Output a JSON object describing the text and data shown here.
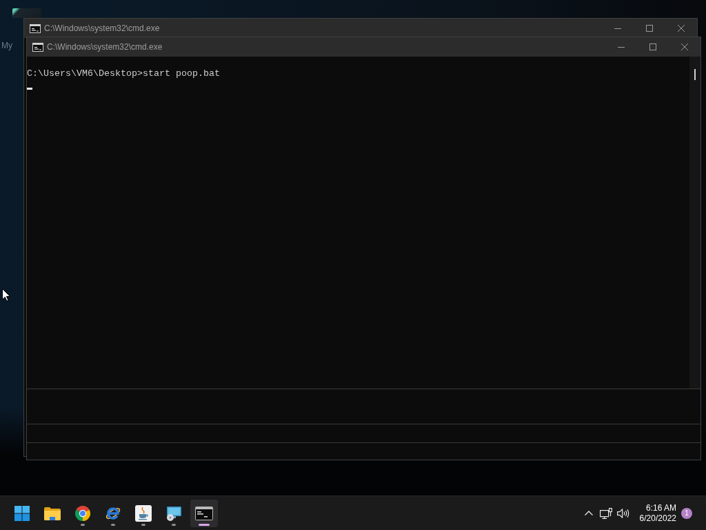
{
  "desktop": {
    "icons": [
      {
        "label": "My"
      }
    ]
  },
  "windows": [
    {
      "title": "C:\\Windows\\system32\\cmd.exe"
    },
    {
      "title": "C:\\Windows\\system32\\cmd.exe",
      "console": {
        "lines": [
          "C:\\Users\\VM6\\Desktop>start poop.bat"
        ]
      }
    }
  ],
  "taskbar": {
    "apps": [
      {
        "kind": "start",
        "running": false,
        "selected": false
      },
      {
        "kind": "folder",
        "running": false,
        "selected": false
      },
      {
        "kind": "circle-logo",
        "running": true,
        "selected": false
      },
      {
        "kind": "e-logo",
        "running": true,
        "selected": false
      },
      {
        "kind": "coffee-cup",
        "running": true,
        "selected": false
      },
      {
        "kind": "monitor-disc",
        "running": true,
        "selected": false
      },
      {
        "kind": "terminal",
        "running": true,
        "selected": true
      }
    ],
    "tray": [
      {
        "kind": "chevron"
      },
      {
        "kind": "network"
      },
      {
        "kind": "speaker"
      }
    ],
    "clock": {
      "time": "6:16 AM",
      "date": "6/20/2022"
    },
    "notifications": {
      "count": "1"
    }
  }
}
